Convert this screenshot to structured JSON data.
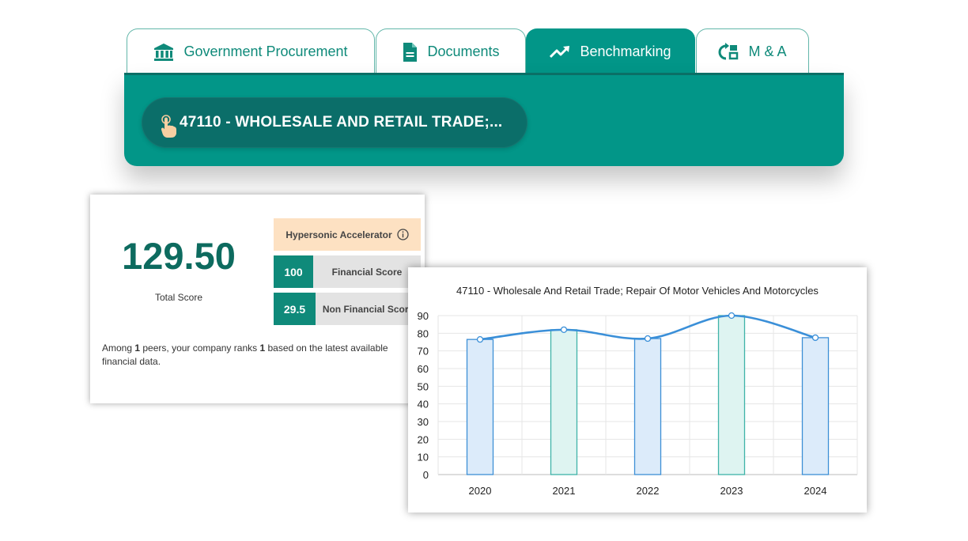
{
  "tabs": [
    {
      "label": "Government Procurement",
      "icon": "bank-icon",
      "active": false
    },
    {
      "label": "Documents",
      "icon": "document-icon",
      "active": false
    },
    {
      "label": "Benchmarking",
      "icon": "trending-up-icon",
      "active": true
    },
    {
      "label": "M & A",
      "icon": "swap-icon",
      "active": false
    }
  ],
  "industry": {
    "label": "47110 - WHOLESALE AND RETAIL TRADE;...",
    "icon": "pointer-hand-icon"
  },
  "score_card": {
    "total_score": "129.50",
    "total_label": "Total Score",
    "accelerator_label": "Hypersonic Accelerator",
    "financial": {
      "value": "100",
      "label": "Financial Score"
    },
    "non_financial": {
      "value": "29.5",
      "label": "Non Financial Score"
    },
    "rank_prefix": "Among ",
    "peer_count": "1",
    "rank_middle": " peers, your company ranks ",
    "rank_value": "1",
    "rank_suffix": " based on the latest available financial data."
  },
  "colors": {
    "teal": "#029688",
    "dark_teal": "#0b6e69",
    "accent_orange": "#fde1c2",
    "line_blue": "#3a8fd8"
  },
  "chart_data": {
    "type": "bar",
    "title": "47110 - Wholesale And Retail Trade; Repair Of Motor Vehicles And Motorcycles",
    "categories": [
      "2020",
      "2021",
      "2022",
      "2023",
      "2024"
    ],
    "series": [
      {
        "type": "bar",
        "values": [
          76.5,
          82,
          77,
          90,
          77.5
        ]
      },
      {
        "type": "line",
        "smooth": true,
        "values": [
          76.5,
          82,
          77,
          90,
          77.5
        ]
      }
    ],
    "ylim": [
      0,
      90
    ],
    "yticks": [
      0,
      10,
      20,
      30,
      40,
      50,
      60,
      70,
      80,
      90
    ],
    "grid": true,
    "xlabel": "",
    "ylabel": ""
  }
}
